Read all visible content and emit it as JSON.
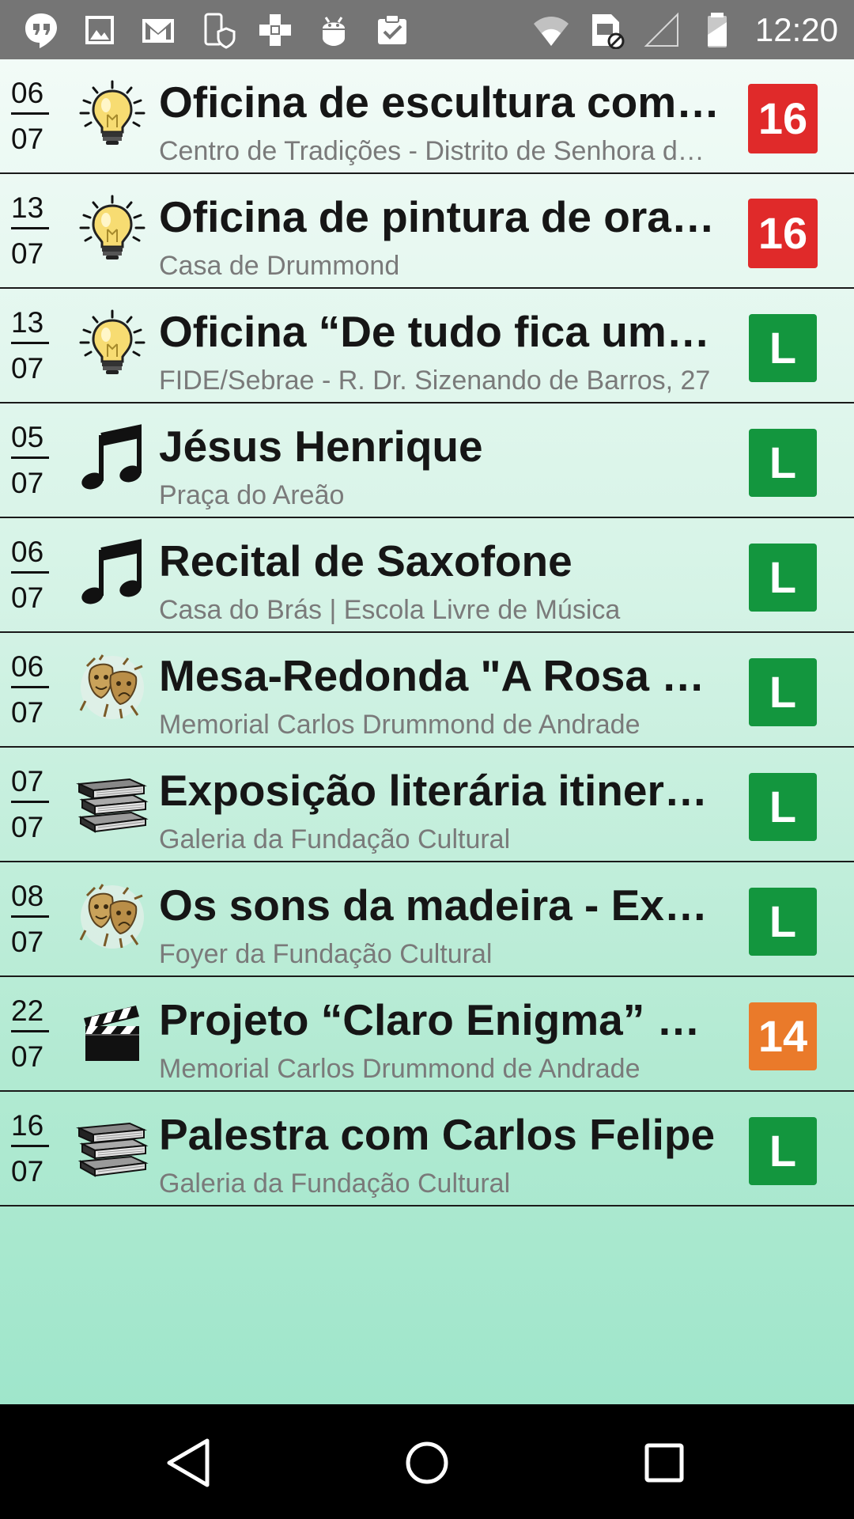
{
  "status_bar": {
    "time": "12:20",
    "left_icons": [
      "hangouts-icon",
      "gallery-icon",
      "gmail-icon",
      "phone-shield-icon",
      "plus-cross-icon",
      "android-icon",
      "clipboard-check-icon"
    ],
    "right_icons": [
      "wifi-icon",
      "sim-blocked-icon",
      "signal-icon",
      "battery-icon"
    ]
  },
  "colors": {
    "rating_16": "#e02a2a",
    "rating_L": "#13963e",
    "rating_14": "#ea7a2a"
  },
  "events": [
    {
      "day": "06",
      "month": "07",
      "icon": "lightbulb-icon",
      "title": "Oficina de escultura com …",
      "venue": "Centro de Tradições - Distrito de Senhora d…",
      "rating": "16",
      "rating_color": "#e02a2a"
    },
    {
      "day": "13",
      "month": "07",
      "icon": "lightbulb-icon",
      "title": "Oficina de pintura de orat…",
      "venue": "Casa de Drummond",
      "rating": "16",
      "rating_color": "#e02a2a"
    },
    {
      "day": "13",
      "month": "07",
      "icon": "lightbulb-icon",
      "title": "Oficina “De tudo fica um p…",
      "venue": "FIDE/Sebrae - R. Dr. Sizenando de Barros, 27",
      "rating": "L",
      "rating_color": "#13963e"
    },
    {
      "day": "05",
      "month": "07",
      "icon": "music-note-icon",
      "title": "Jésus Henrique",
      "venue": "Praça do Areão",
      "rating": "L",
      "rating_color": "#13963e"
    },
    {
      "day": "06",
      "month": "07",
      "icon": "music-note-icon",
      "title": "Recital de Saxofone",
      "venue": "Casa do Brás | Escola Livre de Música",
      "rating": "L",
      "rating_color": "#13963e"
    },
    {
      "day": "06",
      "month": "07",
      "icon": "theater-masks-icon",
      "title": "Mesa-Redonda \"A Rosa d…",
      "venue": "Memorial Carlos Drummond de Andrade",
      "rating": "L",
      "rating_color": "#13963e"
    },
    {
      "day": "07",
      "month": "07",
      "icon": "books-icon",
      "title": "Exposição literária itinera…",
      "venue": "Galeria da Fundação Cultural",
      "rating": "L",
      "rating_color": "#13963e"
    },
    {
      "day": "08",
      "month": "07",
      "icon": "theater-masks-icon",
      "title": "Os sons da madeira - Exp…",
      "venue": "Foyer da Fundação Cultural",
      "rating": "L",
      "rating_color": "#13963e"
    },
    {
      "day": "22",
      "month": "07",
      "icon": "clapperboard-icon",
      "title": "Projeto “Claro Enigma” – …",
      "venue": "Memorial Carlos Drummond de Andrade",
      "rating": "14",
      "rating_color": "#ea7a2a"
    },
    {
      "day": "16",
      "month": "07",
      "icon": "books-icon",
      "title": "Palestra com Carlos Felipe",
      "venue": "Galeria da Fundação Cultural",
      "rating": "L",
      "rating_color": "#13963e"
    }
  ],
  "nav_bar": {
    "buttons": [
      "back-icon",
      "home-icon",
      "recents-icon"
    ]
  }
}
